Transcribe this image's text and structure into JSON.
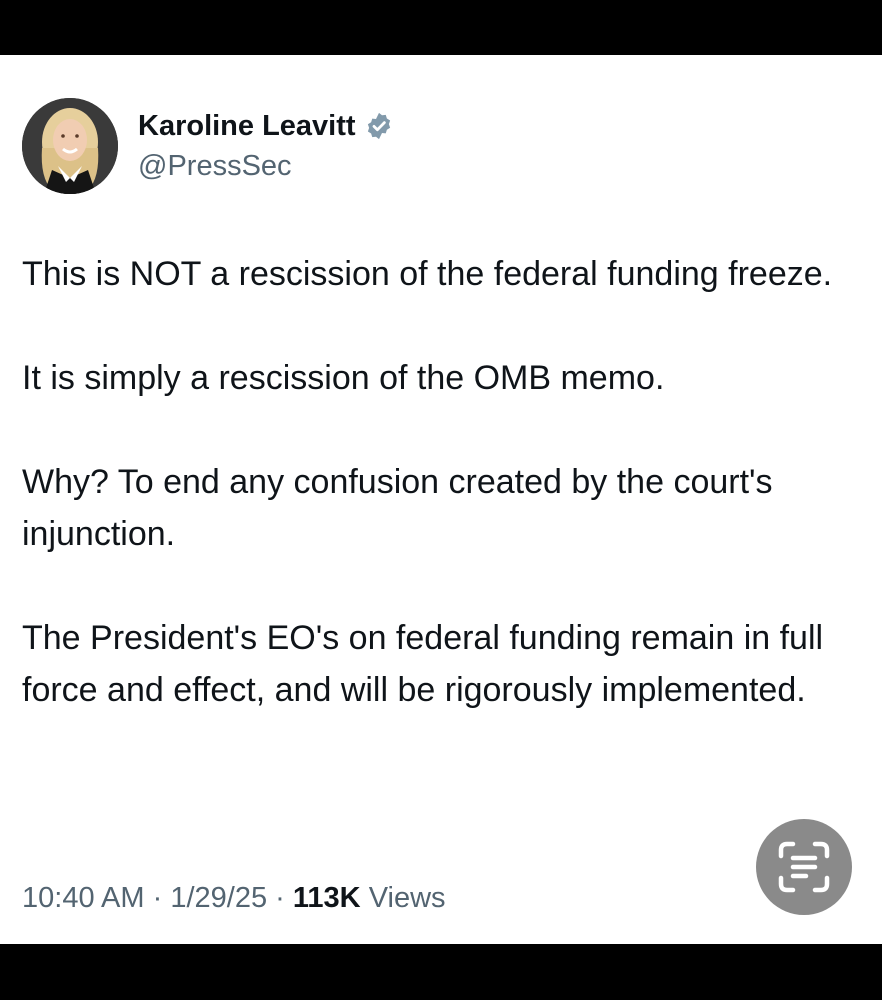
{
  "author": {
    "name": "Karoline Leavitt",
    "handle": "@PressSec",
    "verified": true,
    "verified_color": "#829aab"
  },
  "tweet": {
    "paragraphs": [
      "This is NOT a rescission of the federal funding freeze.",
      "It is simply a rescission of the OMB memo.",
      "Why? To end any confusion created by the court's injunction.",
      "The President's EO's on federal funding remain in full force and effect, and will be rigorously implemented."
    ],
    "time": "10:40 AM",
    "date": "1/29/25",
    "separator": "·",
    "views_count": "113K",
    "views_label": "Views"
  },
  "overlay": {
    "lens_icon": "text-scan-icon"
  },
  "colors": {
    "text": "#0f1419",
    "secondary": "#536471",
    "bars": "#000000",
    "lens_button": "#8a8a8a"
  }
}
